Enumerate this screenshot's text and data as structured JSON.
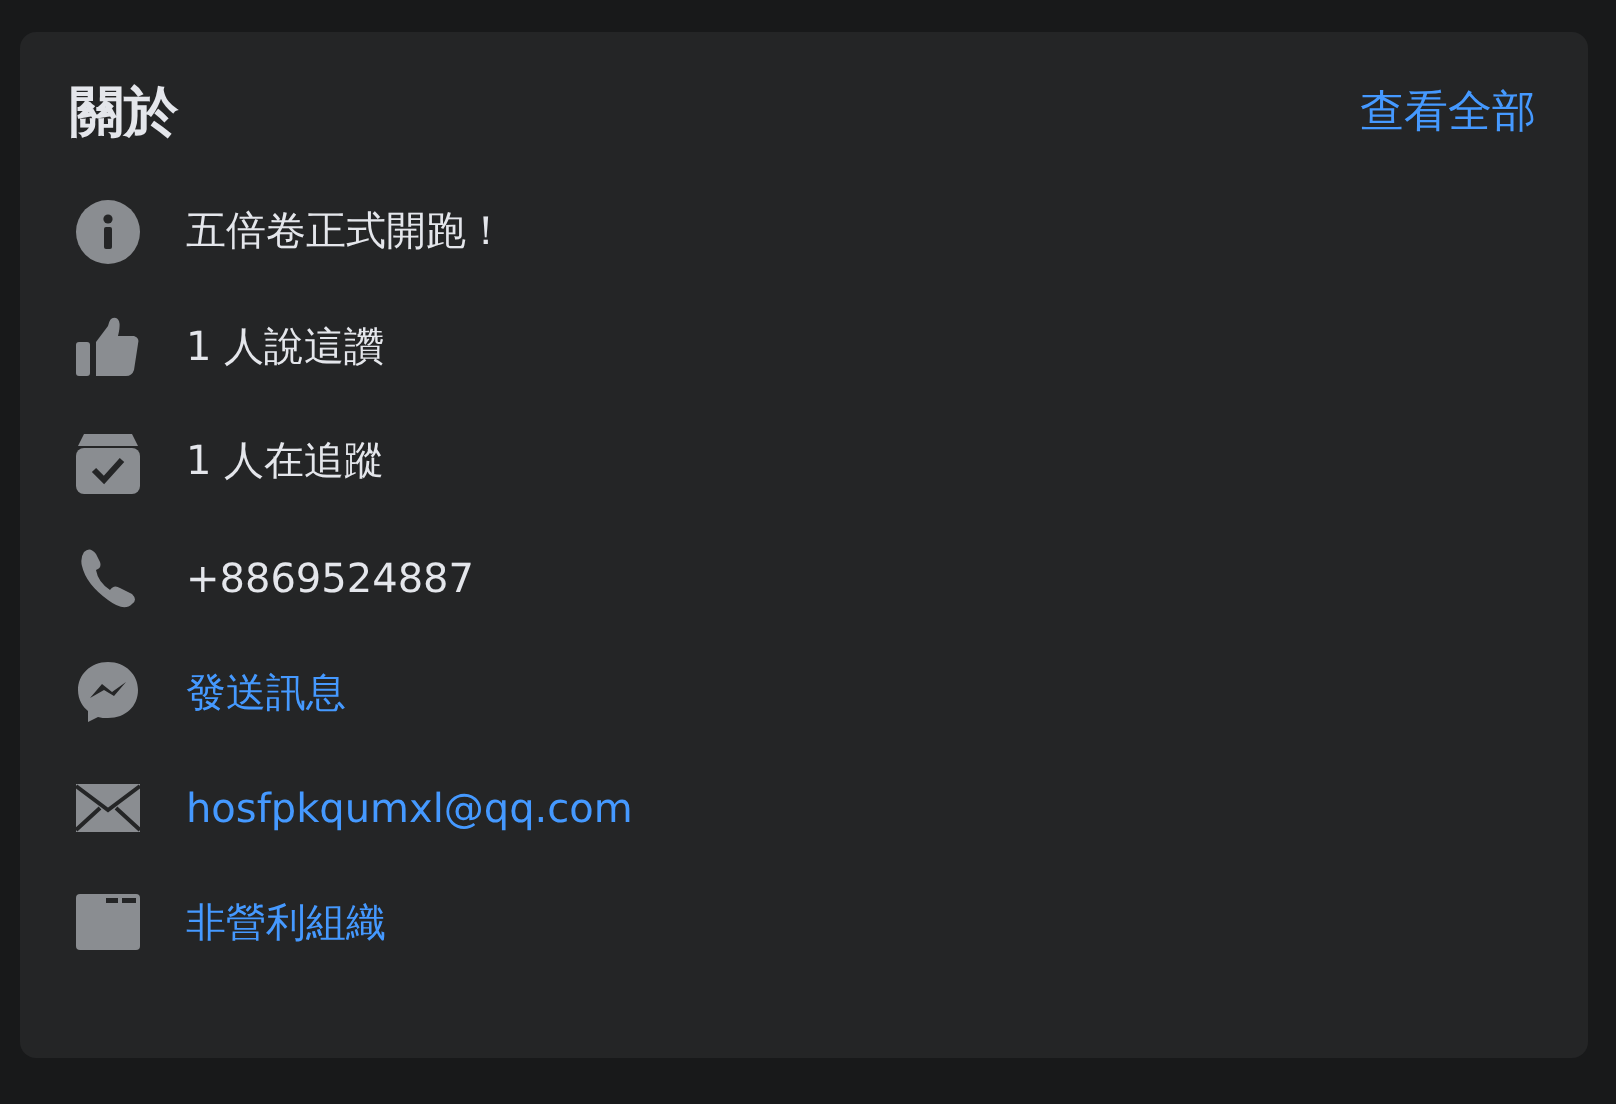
{
  "card": {
    "title": "關於",
    "see_all": "查看全部"
  },
  "items": [
    {
      "kind": "text",
      "text": "五倍卷正式開跑！"
    },
    {
      "kind": "text",
      "text": "1 人說這讚"
    },
    {
      "kind": "text",
      "text": "1 人在追蹤"
    },
    {
      "kind": "text",
      "text": "+8869524887"
    },
    {
      "kind": "link",
      "text": "發送訊息"
    },
    {
      "kind": "link",
      "text": "hosfpkqumxl@qq.com"
    },
    {
      "kind": "link",
      "text": "非營利組織"
    }
  ]
}
